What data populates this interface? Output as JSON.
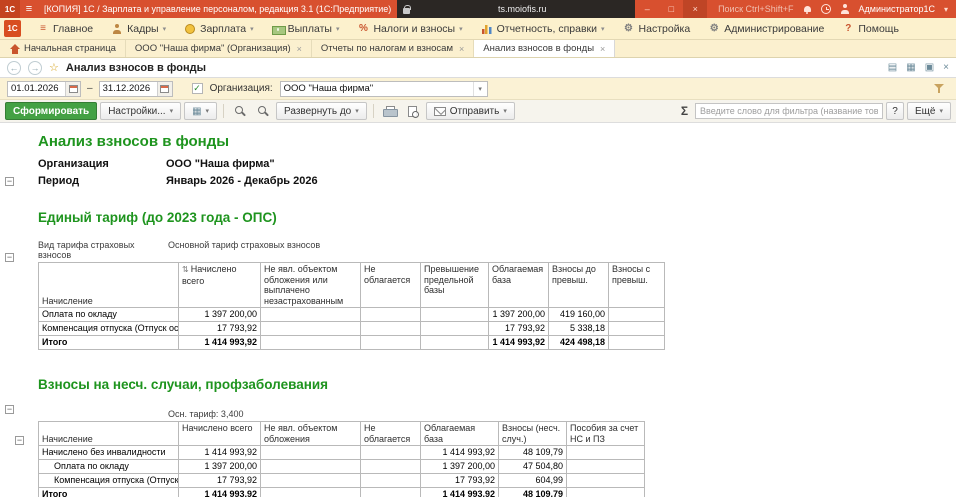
{
  "glyphs": {
    "burger": "≡",
    "chevron_down": "▾",
    "minimize": "–",
    "maximize": "□",
    "close": "×",
    "back": "←",
    "forward": "→",
    "star": "☆",
    "check": "✓",
    "sort": "⇅",
    "collapse": "−",
    "percent": "%",
    "gear": "⚙",
    "question": "?",
    "list": "▤",
    "grid": "▦",
    "windows": "▣"
  },
  "titlebar": {
    "app_title": "[КОПИЯ] 1С / Зарплата и управление персоналом, редакция 3.1 (1С:Предприятие)",
    "url": "ts.moiofis.ru",
    "search_hint": "Поиск Ctrl+Shift+F",
    "user_name": "Администратор1С"
  },
  "menubar": {
    "items": [
      {
        "id": "main",
        "label": "Главное",
        "icon": "home",
        "arrow": false
      },
      {
        "id": "kadry",
        "label": "Кадры",
        "icon": "people",
        "arrow": true
      },
      {
        "id": "zarplata",
        "label": "Зарплата",
        "icon": "salary",
        "arrow": true
      },
      {
        "id": "vyplaty",
        "label": "Выплаты",
        "icon": "payments",
        "arrow": true
      },
      {
        "id": "nalogi",
        "label": "Налоги и взносы",
        "icon": "percent",
        "arrow": true
      },
      {
        "id": "otchetnost",
        "label": "Отчетность, справки",
        "icon": "reports",
        "arrow": true
      },
      {
        "id": "nastroyka",
        "label": "Настройка",
        "icon": "gear",
        "arrow": false
      },
      {
        "id": "administrirovanie",
        "label": "Администрирование",
        "icon": "gear",
        "arrow": false
      },
      {
        "id": "pomosch",
        "label": "Помощь",
        "icon": "question",
        "arrow": false
      }
    ]
  },
  "tabbar": {
    "home_label": "Начальная страница",
    "tabs": [
      {
        "label": "ООО \"Наша фирма\" (Организация)",
        "active": false
      },
      {
        "label": "Отчеты по налогам и взносам",
        "active": false
      },
      {
        "label": "Анализ взносов в фонды",
        "active": true
      }
    ]
  },
  "formbar": {
    "title": "Анализ взносов в фонды"
  },
  "filterbar": {
    "date_from": "01.01.2026",
    "date_sep": "–",
    "date_to": "31.12.2026",
    "org_label": "Организация:",
    "org_value": "ООО \"Наша фирма\""
  },
  "toolbar": {
    "generate_label": "Сформировать",
    "settings_label": "Настройки...",
    "expand_label": "Развернуть до",
    "send_label": "Отправить",
    "sum_symbol": "Σ",
    "filter_placeholder": "Введите слово для фильтра (название товара, покупателя и пр.)",
    "help_label": "?",
    "more_label": "Ещё"
  },
  "report": {
    "title": "Анализ взносов в фонды",
    "org_label": "Организация",
    "org_value": "ООО \"Наша фирма\"",
    "period_label": "Период",
    "period_value": "Январь 2026 - Декабрь 2026",
    "heading_color": "#1e941e",
    "section1": {
      "heading": "Единый тариф (до 2023 года - ОПС)",
      "meta_left": "Вид тарифа страховых взносов",
      "meta_right": "Основной тариф страховых взносов",
      "columns": [
        "Начисление",
        "Начислено всего",
        "Не явл. объектом обложения или выплачено незастрахованным",
        "Не облагается",
        "Превышение предельной базы",
        "Облагаемая база",
        "Взносы до превыш.",
        "Взносы с превыш."
      ],
      "rows": [
        {
          "name": "Оплата по окладу",
          "indent": 0,
          "bold": false,
          "values": [
            "1 397 200,00",
            "",
            "",
            "",
            "1 397 200,00",
            "419 160,00",
            ""
          ]
        },
        {
          "name": "Компенсация отпуска (Отпуск основной)",
          "indent": 0,
          "bold": false,
          "values": [
            "17 793,92",
            "",
            "",
            "",
            "17 793,92",
            "5 338,18",
            ""
          ]
        },
        {
          "name": "Итого",
          "indent": 0,
          "bold": true,
          "values": [
            "1 414 993,92",
            "",
            "",
            "",
            "1 414 993,92",
            "424 498,18",
            ""
          ]
        }
      ]
    },
    "section2": {
      "heading": "Взносы на несч. случаи, профзаболевания",
      "tariff": "Осн. тариф: 3,400",
      "columns": [
        "Начисление",
        "Начислено всего",
        "Не явл. объектом обложения",
        "Не облагается",
        "Облагаемая база",
        "Взносы (несч. случ.)",
        "Пособия за счет НС и ПЗ"
      ],
      "rows": [
        {
          "name": "Начислено без инвалидности",
          "indent": 0,
          "bold": false,
          "values": [
            "1 414 993,92",
            "",
            "",
            "1 414 993,92",
            "48 109,79",
            ""
          ]
        },
        {
          "name": "Оплата по окладу",
          "indent": 1,
          "bold": false,
          "values": [
            "1 397 200,00",
            "",
            "",
            "1 397 200,00",
            "47 504,80",
            ""
          ]
        },
        {
          "name": "Компенсация отпуска (Отпуск основной)",
          "indent": 1,
          "bold": false,
          "values": [
            "17 793,92",
            "",
            "",
            "17 793,92",
            "604,99",
            ""
          ]
        },
        {
          "name": "Итого",
          "indent": 0,
          "bold": true,
          "values": [
            "1 414 993,92",
            "",
            "",
            "1 414 993,92",
            "48 109,79",
            ""
          ]
        }
      ]
    }
  }
}
